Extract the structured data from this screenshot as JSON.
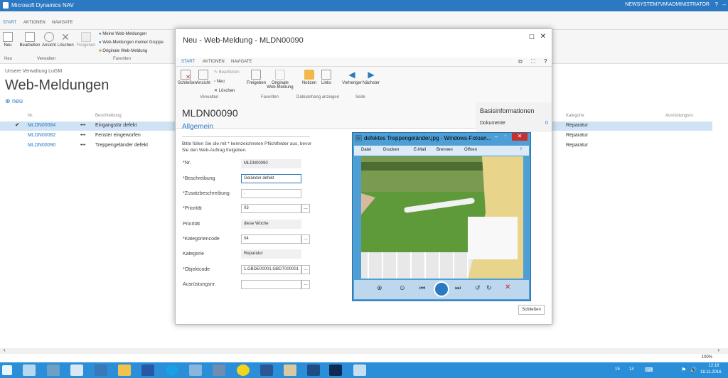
{
  "window": {
    "title": "Microsoft Dynamics NAV",
    "user": "NEWSYSTEM7VM\\ADMINISTRATOR"
  },
  "ribbon": {
    "tabs": [
      "START",
      "AKTIONEN",
      "NAVIGATE"
    ],
    "buttons": {
      "neu": "Neu",
      "bearbeiten": "Bearbeiten",
      "ansicht": "Ansicht",
      "loeschen": "Löschen",
      "freigeben": "Freigeben"
    },
    "favorites": [
      "Meine Web-Meldungen",
      "Web-Meldungen meiner Gruppe",
      "Originale Web-Meldung"
    ],
    "groups": {
      "neu": "Neu",
      "verwalten": "Verwalten",
      "favoriten": "Favoriten"
    }
  },
  "page": {
    "breadcrumb": "Unsere Verwaltung LuGM",
    "title": "Web-Meldungen",
    "new_label": "neu",
    "columns": {
      "nr": "Nr.",
      "beschreibung": "Beschreibung",
      "kategorie": "Kategorie",
      "ausruestung": "Ausrüstungsnr."
    },
    "rows": [
      {
        "nr": "MLDN00084",
        "beschreibung": "Eingangstür defekt",
        "kategorie": "Reparatur"
      },
      {
        "nr": "MLDN00082",
        "beschreibung": "Fenster eingeworfen",
        "kategorie": "Reparatur"
      },
      {
        "nr": "MLDN00090",
        "beschreibung": "Treppengeländer defekt",
        "kategorie": "Reparatur"
      }
    ]
  },
  "dialog": {
    "title": "Neu - Web-Meldung - MLDN00090",
    "tabs": [
      "START",
      "AKTIONEN",
      "NAVIGATE"
    ],
    "buttons": {
      "schliessen": "Schließen",
      "ansicht": "Ansicht",
      "bearbeiten": "Bearbeiten",
      "neu": "Neu",
      "loeschen": "Löschen",
      "freigeben": "Freigeben",
      "originale": "Originale Web-Meldung",
      "notizen": "Notizen",
      "links": "Links",
      "vorheriger": "Vorheriger",
      "naechster": "Nächster"
    },
    "groups": {
      "verwalten": "Verwalten",
      "favoriten": "Favoriten",
      "dateianhang": "Dateianhang anzeigen",
      "seite": "Seite"
    },
    "record_no": "MLDN00090",
    "section": "Allgemein",
    "hint": "Bitte füllen Sie die mit * kennzeichneten Pflichtfelder aus, bevor Sie den Web-Auftrag freigeben.",
    "fields": [
      {
        "label": "*Nr.",
        "value": "MLDN00090"
      },
      {
        "label": "*Beschreibung",
        "value": "Geländer defekt"
      },
      {
        "label": "*Zusatzbeschreibung",
        "value": "."
      },
      {
        "label": "*Priorität",
        "value": "03"
      },
      {
        "label": "Priorität",
        "value": "diese Woche"
      },
      {
        "label": "*Kategoriencode",
        "value": "04"
      },
      {
        "label": "Kategorie",
        "value": "Reparatur"
      },
      {
        "label": "*Objektcode",
        "value": "1.GBDE00001.GBDT000001"
      },
      {
        "label": "Ausrüstungsnr.",
        "value": ""
      }
    ],
    "factbox": {
      "title": "Basisinformationen",
      "dokumente_label": "Dokumente",
      "dokumente_value": "0"
    },
    "close_button": "Schließen"
  },
  "viewer": {
    "title": "defektes Treppengeländer.jpg - Windows-Fotoan...",
    "menu": [
      "Datei",
      "Drucken",
      "E-Mail",
      "Brennen",
      "Öffnen"
    ]
  },
  "status": {
    "zoom": "100%"
  },
  "taskbar": {
    "time": "12:18",
    "date": "18.11.2016",
    "num1": "15",
    "num2": "14"
  }
}
